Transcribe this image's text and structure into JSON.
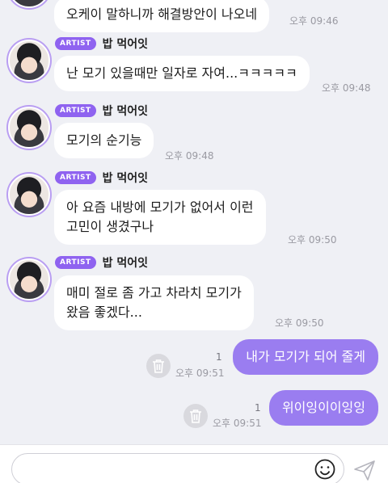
{
  "messages": [
    {
      "type": "in",
      "text": "오케이 말하니까 해결방안이 나오네",
      "time": "오후 09:46"
    },
    {
      "type": "in",
      "badge": "ARTIST",
      "sender": "밥 먹어잇",
      "text": "난 모기 있을때만 일자로 자여...ㅋㅋㅋㅋㅋ",
      "time": "오후 09:48"
    },
    {
      "type": "in",
      "badge": "ARTIST",
      "sender": "밥 먹어잇",
      "text": "모기의 순기능",
      "time": "오후 09:48"
    },
    {
      "type": "in",
      "badge": "ARTIST",
      "sender": "밥 먹어잇",
      "text": "아 요즘 내방에 모기가 없어서 이런\n고민이 생겼구나",
      "time": "오후 09:50"
    },
    {
      "type": "in",
      "badge": "ARTIST",
      "sender": "밥 먹어잇",
      "text": "매미 절로 좀 가고 차라치 모기가\n왔음 좋겠다...",
      "time": "오후 09:50"
    },
    {
      "type": "out",
      "text": "내가 모기가 되어 줄게",
      "time": "오후 09:51",
      "unread": "1"
    },
    {
      "type": "out",
      "text": "위이잉이이잉잉",
      "time": "오후 09:51",
      "unread": "1"
    }
  ],
  "input": {
    "placeholder": ""
  },
  "icons": {
    "emoji": "smiley-icon",
    "send": "send-icon",
    "delete": "trash-icon"
  },
  "colors": {
    "outgoing_bubble": "#9a7df0",
    "artist_badge": "#8f63f0",
    "background": "#eff0f5"
  }
}
